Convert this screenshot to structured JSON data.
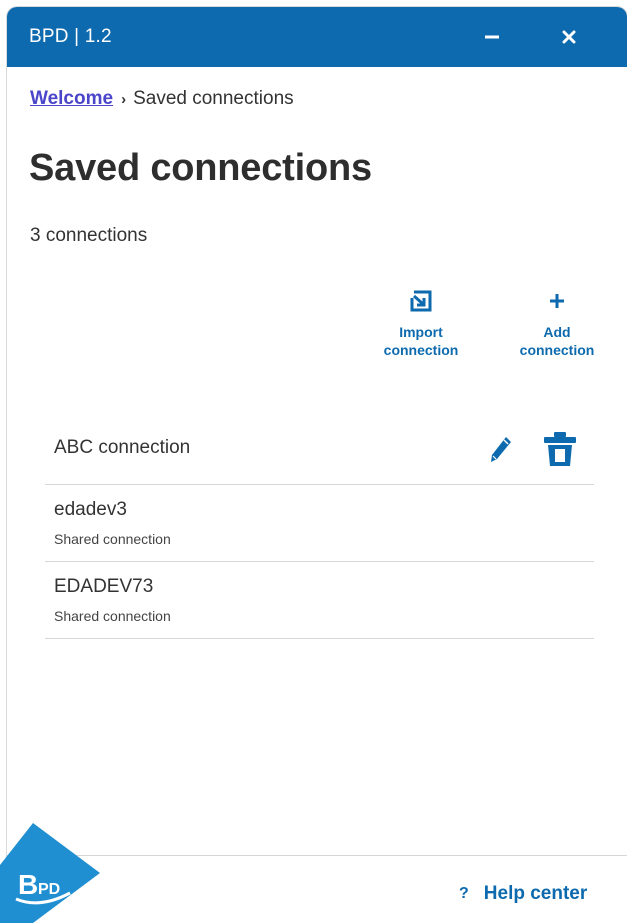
{
  "window": {
    "title": "BPD | 1.2",
    "minimize_icon": "minimize-icon",
    "close_icon": "close-icon"
  },
  "breadcrumb": {
    "link": "Welcome",
    "current": "Saved connections"
  },
  "page": {
    "title": "Saved connections",
    "count_text": "3 connections"
  },
  "actions": {
    "import_label": "Import\nconnection",
    "add_label": "Add\nconnection",
    "import_icon": "import-icon",
    "add_icon": "plus-icon"
  },
  "connections": [
    {
      "name": "ABC connection",
      "subtitle": ""
    },
    {
      "name": "edadev3",
      "subtitle": "Shared connection"
    },
    {
      "name": "EDADEV73",
      "subtitle": "Shared connection"
    }
  ],
  "footer": {
    "help_label": "Help center",
    "help_icon": "?",
    "logo_text": "BPD"
  },
  "colors": {
    "brand": "#0d6aae",
    "link": "#4a45c9",
    "logo": "#1f8fd1"
  }
}
